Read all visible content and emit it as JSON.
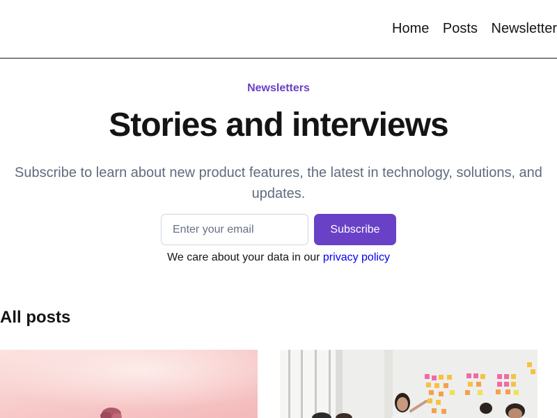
{
  "nav": {
    "links": [
      "Home",
      "Posts",
      "Newsletter"
    ]
  },
  "hero": {
    "eyebrow": "Newsletters",
    "title": "Stories and interviews",
    "subtitle": "Subscribe to learn about new product features, the latest in technology, solutions, and updates."
  },
  "signup": {
    "email_placeholder": "Enter your email",
    "button_label": "Subscribe",
    "privacy_text": "We care about your data in our",
    "privacy_link": "privacy policy"
  },
  "posts": {
    "heading": "All posts",
    "cards": [
      {
        "image": "pink-sky-tree-photo"
      },
      {
        "image": "office-sticky-notes-photo"
      }
    ]
  },
  "colors": {
    "accent": "#6941c6",
    "text": "#141414",
    "muted": "#5f6b7e",
    "link": "#0000ee"
  }
}
